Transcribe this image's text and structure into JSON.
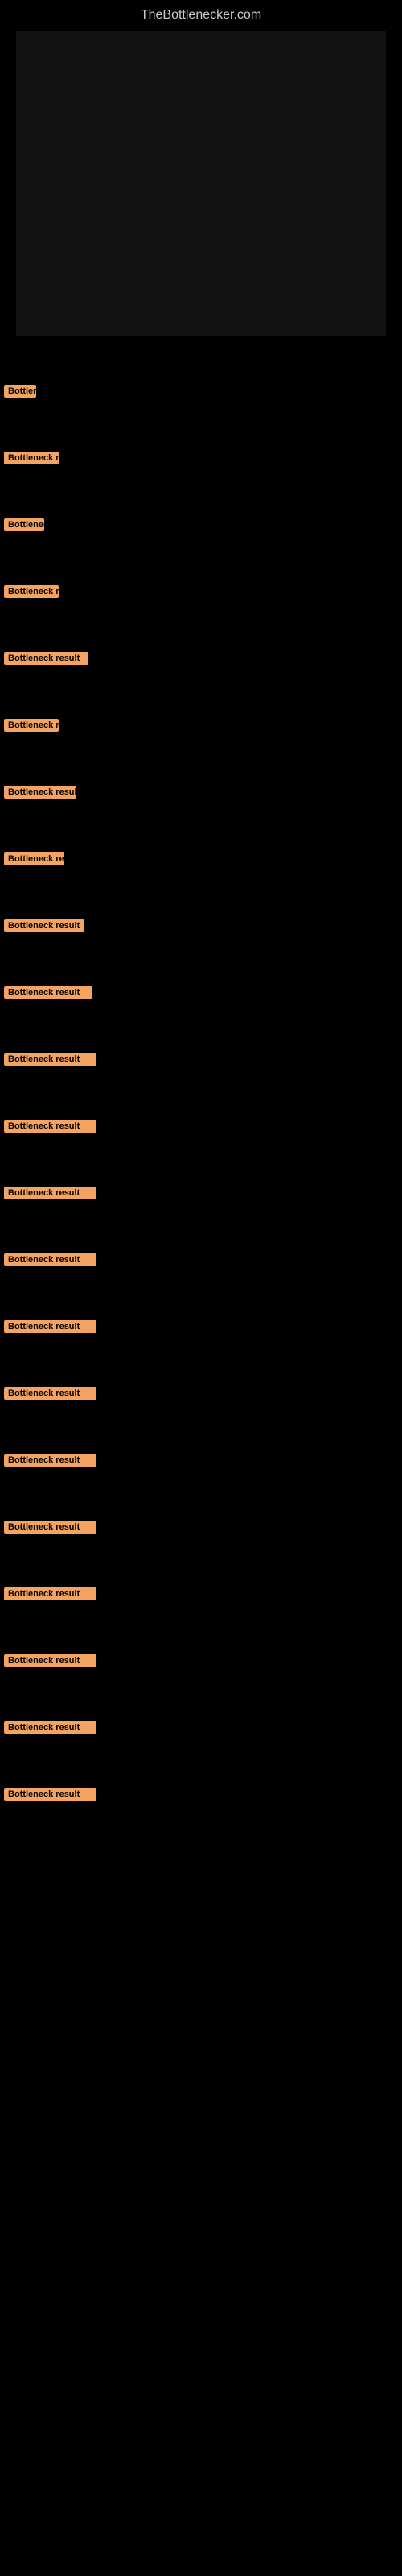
{
  "site": {
    "title": "TheBottlenecker.com"
  },
  "chart": {
    "placeholder_text": ""
  },
  "results": [
    {
      "id": 1,
      "label": "Bottleneck result",
      "width_class": "label-w1"
    },
    {
      "id": 2,
      "label": "Bottleneck result",
      "width_class": "label-w2"
    },
    {
      "id": 3,
      "label": "Bottleneck result",
      "width_class": "label-w3"
    },
    {
      "id": 4,
      "label": "Bottleneck result",
      "width_class": "label-w4"
    },
    {
      "id": 5,
      "label": "Bottleneck result",
      "width_class": "label-w5"
    },
    {
      "id": 6,
      "label": "Bottleneck result",
      "width_class": "label-w6"
    },
    {
      "id": 7,
      "label": "Bottleneck result",
      "width_class": "label-w7"
    },
    {
      "id": 8,
      "label": "Bottleneck result",
      "width_class": "label-w8"
    },
    {
      "id": 9,
      "label": "Bottleneck result",
      "width_class": "label-w9"
    },
    {
      "id": 10,
      "label": "Bottleneck result",
      "width_class": "label-w10"
    },
    {
      "id": 11,
      "label": "Bottleneck result",
      "width_class": "label-w11"
    },
    {
      "id": 12,
      "label": "Bottleneck result",
      "width_class": "label-w12"
    },
    {
      "id": 13,
      "label": "Bottleneck result",
      "width_class": "label-w13"
    },
    {
      "id": 14,
      "label": "Bottleneck result",
      "width_class": "label-w14"
    },
    {
      "id": 15,
      "label": "Bottleneck result",
      "width_class": "label-w15"
    },
    {
      "id": 16,
      "label": "Bottleneck result",
      "width_class": "label-w16"
    },
    {
      "id": 17,
      "label": "Bottleneck result",
      "width_class": "label-w17"
    },
    {
      "id": 18,
      "label": "Bottleneck result",
      "width_class": "label-w18"
    },
    {
      "id": 19,
      "label": "Bottleneck result",
      "width_class": "label-w19"
    },
    {
      "id": 20,
      "label": "Bottleneck result",
      "width_class": "label-w20"
    },
    {
      "id": 21,
      "label": "Bottleneck result",
      "width_class": "label-w21"
    },
    {
      "id": 22,
      "label": "Bottleneck result",
      "width_class": "label-w22"
    }
  ]
}
